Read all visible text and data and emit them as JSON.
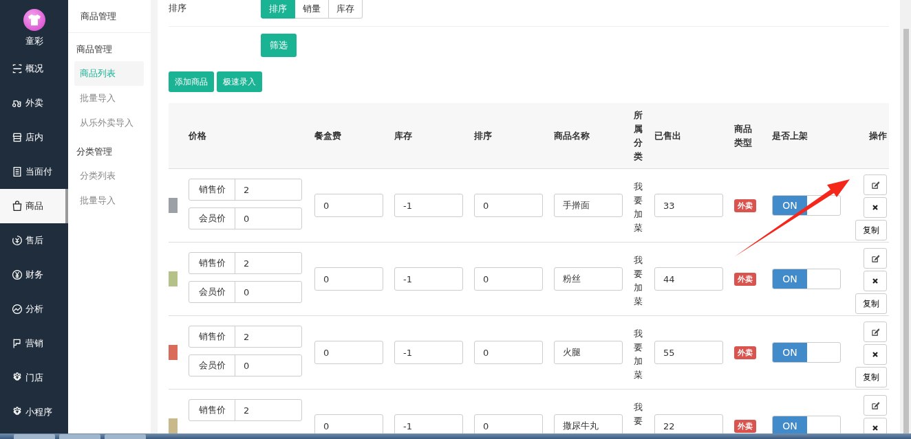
{
  "brand": {
    "name": "童彩"
  },
  "nav": [
    {
      "label": "概况",
      "selected": false
    },
    {
      "label": "外卖",
      "selected": false
    },
    {
      "label": "店内",
      "selected": false
    },
    {
      "label": "当面付",
      "selected": false
    },
    {
      "label": "商品",
      "selected": true
    },
    {
      "label": "售后",
      "selected": false
    },
    {
      "label": "财务",
      "selected": false
    },
    {
      "label": "分析",
      "selected": false
    },
    {
      "label": "营销",
      "selected": false
    },
    {
      "label": "门店",
      "selected": false
    },
    {
      "label": "小程序",
      "selected": false
    }
  ],
  "submenu": {
    "title": "商品管理",
    "groups": [
      {
        "heading": "商品管理",
        "items": [
          {
            "label": "商品列表",
            "selected": true
          },
          {
            "label": "批量导入",
            "selected": false
          },
          {
            "label": "从乐外卖导入",
            "selected": false
          }
        ]
      },
      {
        "heading": "分类管理",
        "items": [
          {
            "label": "分类列表",
            "selected": false
          },
          {
            "label": "批量导入",
            "selected": false
          }
        ]
      }
    ]
  },
  "filter": {
    "label": "排序",
    "options": [
      {
        "label": "排序",
        "selected": true
      },
      {
        "label": "销量",
        "selected": false
      },
      {
        "label": "库存",
        "selected": false
      }
    ],
    "submit": "筛选"
  },
  "toolbar": [
    "添加商品",
    "极速录入"
  ],
  "table": {
    "columns": [
      "价格",
      "餐盒费",
      "库存",
      "排序",
      "商品名称",
      "所属分类",
      "已售出",
      "商品类型",
      "是否上架",
      "操作"
    ],
    "rows": [
      {
        "prices": [
          {
            "label": "销售价",
            "value": "2"
          },
          {
            "label": "会员价",
            "value": "0"
          }
        ],
        "box_fee": "0",
        "stock": "-1",
        "sort": "0",
        "name": "手擀面",
        "category": "我要加菜",
        "sold": "33",
        "type": "外卖",
        "on": true,
        "toggle_label": "ON",
        "copy": "复制"
      },
      {
        "prices": [
          {
            "label": "销售价",
            "value": "2"
          },
          {
            "label": "会员价",
            "value": "0"
          }
        ],
        "box_fee": "0",
        "stock": "-1",
        "sort": "0",
        "name": "粉丝",
        "category": "我要加菜",
        "sold": "44",
        "type": "外卖",
        "on": true,
        "toggle_label": "ON",
        "copy": "复制"
      },
      {
        "prices": [
          {
            "label": "销售价",
            "value": "2"
          },
          {
            "label": "会员价",
            "value": "0"
          }
        ],
        "box_fee": "0",
        "stock": "-1",
        "sort": "0",
        "name": "火腿",
        "category": "我要加菜",
        "sold": "55",
        "type": "外卖",
        "on": true,
        "toggle_label": "ON",
        "copy": "复制"
      },
      {
        "prices": [
          {
            "label": "销售价",
            "value": "2"
          }
        ],
        "box_fee": "0",
        "stock": "-1",
        "sort": "0",
        "name": "撒尿牛丸",
        "category": "我要",
        "sold": "22",
        "type": "外卖",
        "on": true,
        "toggle_label": "ON"
      }
    ]
  }
}
